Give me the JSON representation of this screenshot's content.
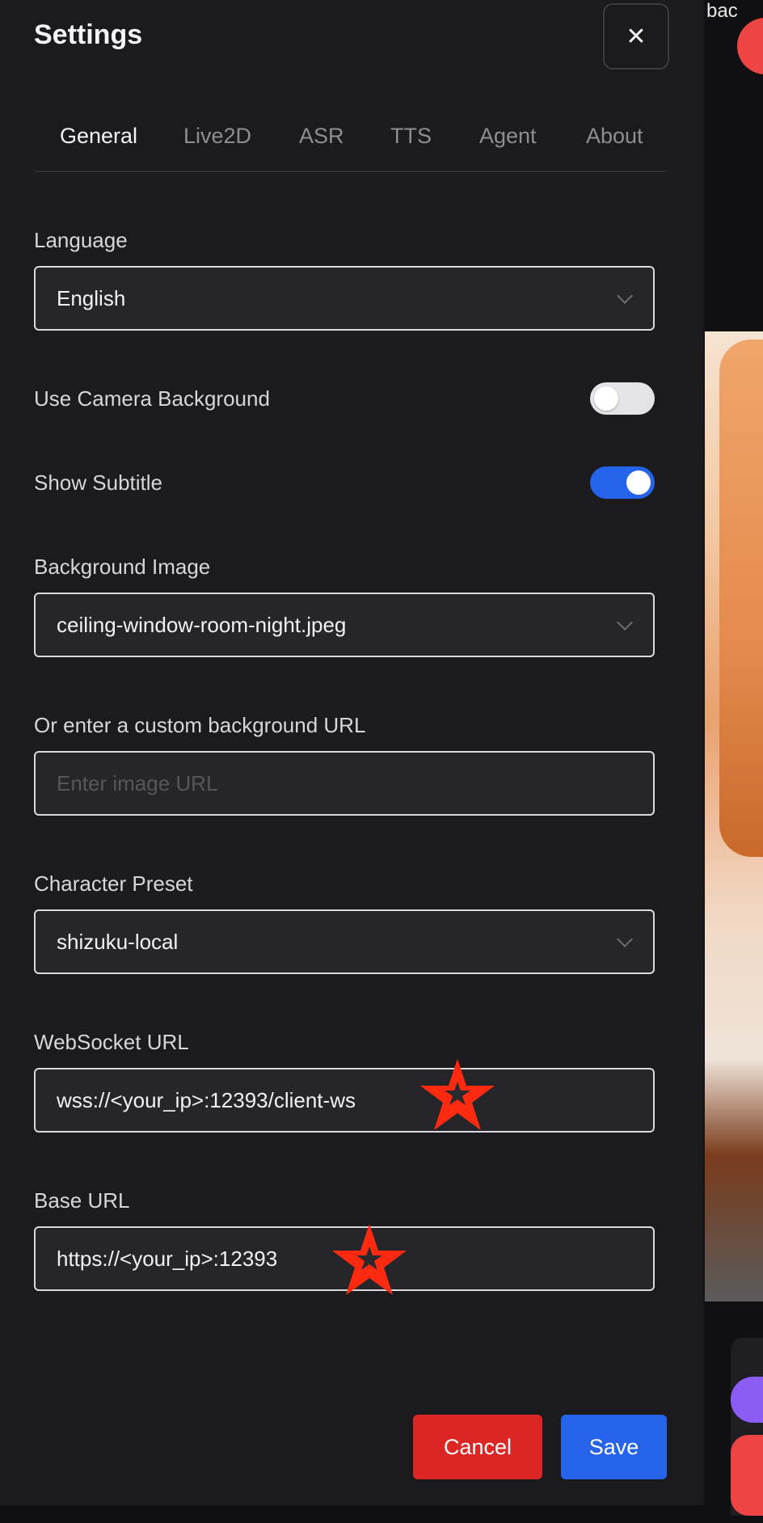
{
  "header": {
    "title": "Settings",
    "close_icon": "close-icon"
  },
  "tabs": [
    {
      "label": "General",
      "active": true
    },
    {
      "label": "Live2D",
      "active": false
    },
    {
      "label": "ASR",
      "active": false
    },
    {
      "label": "TTS",
      "active": false
    },
    {
      "label": "Agent",
      "active": false
    },
    {
      "label": "About",
      "active": false
    }
  ],
  "language": {
    "label": "Language",
    "value": "English"
  },
  "camera_background": {
    "label": "Use Camera Background",
    "enabled": false
  },
  "subtitle": {
    "label": "Show Subtitle",
    "enabled": true
  },
  "background_image": {
    "label": "Background Image",
    "value": "ceiling-window-room-night.jpeg"
  },
  "custom_background": {
    "label": "Or enter a custom background URL",
    "placeholder": "Enter image URL",
    "value": ""
  },
  "character_preset": {
    "label": "Character Preset",
    "value": "shizuku-local"
  },
  "websocket_url": {
    "label": "WebSocket URL",
    "value": "wss://<your_ip>:12393/client-ws"
  },
  "base_url": {
    "label": "Base URL",
    "value": "https://<your_ip>:12393"
  },
  "actions": {
    "cancel_label": "Cancel",
    "save_label": "Save"
  },
  "background_scene": {
    "broken_image_alt": "bac"
  },
  "colors": {
    "primary": "#2563eb",
    "danger": "#dc2626",
    "annotation_star": "#ff2a10",
    "panel_bg": "#1b1b1e"
  }
}
